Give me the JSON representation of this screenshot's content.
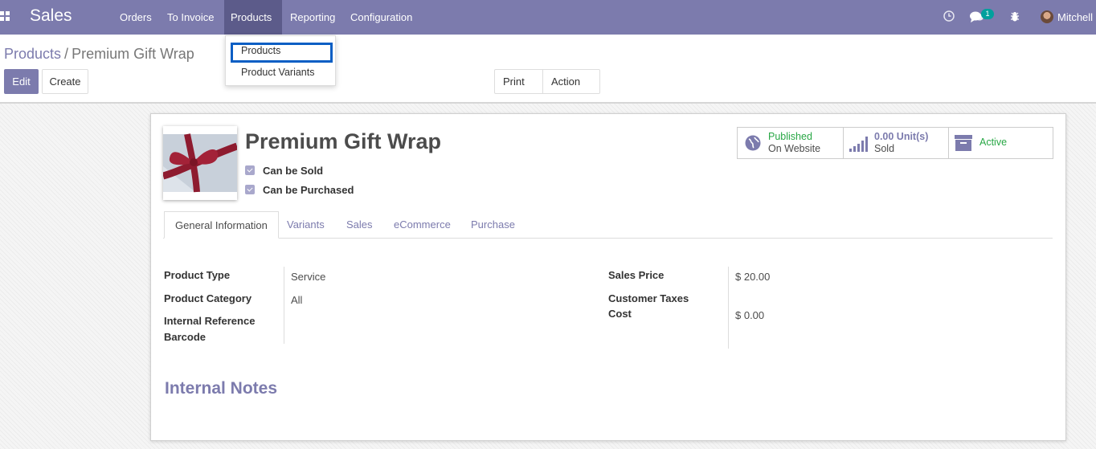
{
  "navbar": {
    "brand": "Sales",
    "menu": [
      "Orders",
      "To Invoice",
      "Products",
      "Reporting",
      "Configuration"
    ],
    "chat_badge": "1",
    "user": "Mitchell"
  },
  "dropdown": {
    "items": [
      "Products",
      "Product Variants"
    ]
  },
  "breadcrumb": {
    "parent": "Products",
    "separator": "/",
    "current": "Premium Gift Wrap"
  },
  "buttons": {
    "edit": "Edit",
    "create": "Create",
    "print": "Print",
    "action": "Action"
  },
  "product": {
    "name": "Premium Gift Wrap",
    "can_be_sold": "Can be Sold",
    "can_be_purchased": "Can be Purchased"
  },
  "smart_buttons": {
    "published_line1": "Published",
    "published_line2": "On Website",
    "sold_line1": "0.00 Unit(s)",
    "sold_line2": "Sold",
    "active": "Active"
  },
  "tabs": [
    "General Information",
    "Variants",
    "Sales",
    "eCommerce",
    "Purchase"
  ],
  "fields": {
    "product_type_label": "Product Type",
    "product_type": "Service",
    "product_category_label": "Product Category",
    "product_category": "All",
    "internal_reference_label": "Internal Reference",
    "barcode_label": "Barcode",
    "sales_price_label": "Sales Price",
    "sales_price": "$ 20.00",
    "customer_taxes_label": "Customer Taxes",
    "cost_label": "Cost",
    "cost": "$ 0.00"
  },
  "notes": {
    "title": "Internal Notes"
  },
  "colors": {
    "navbar": "#7c7bad",
    "active_menu": "#5c5b8a",
    "accent": "#7c7bad",
    "published_green": "#28a745",
    "badge": "#00a09d",
    "highlight_outline": "#0a5ec4"
  }
}
